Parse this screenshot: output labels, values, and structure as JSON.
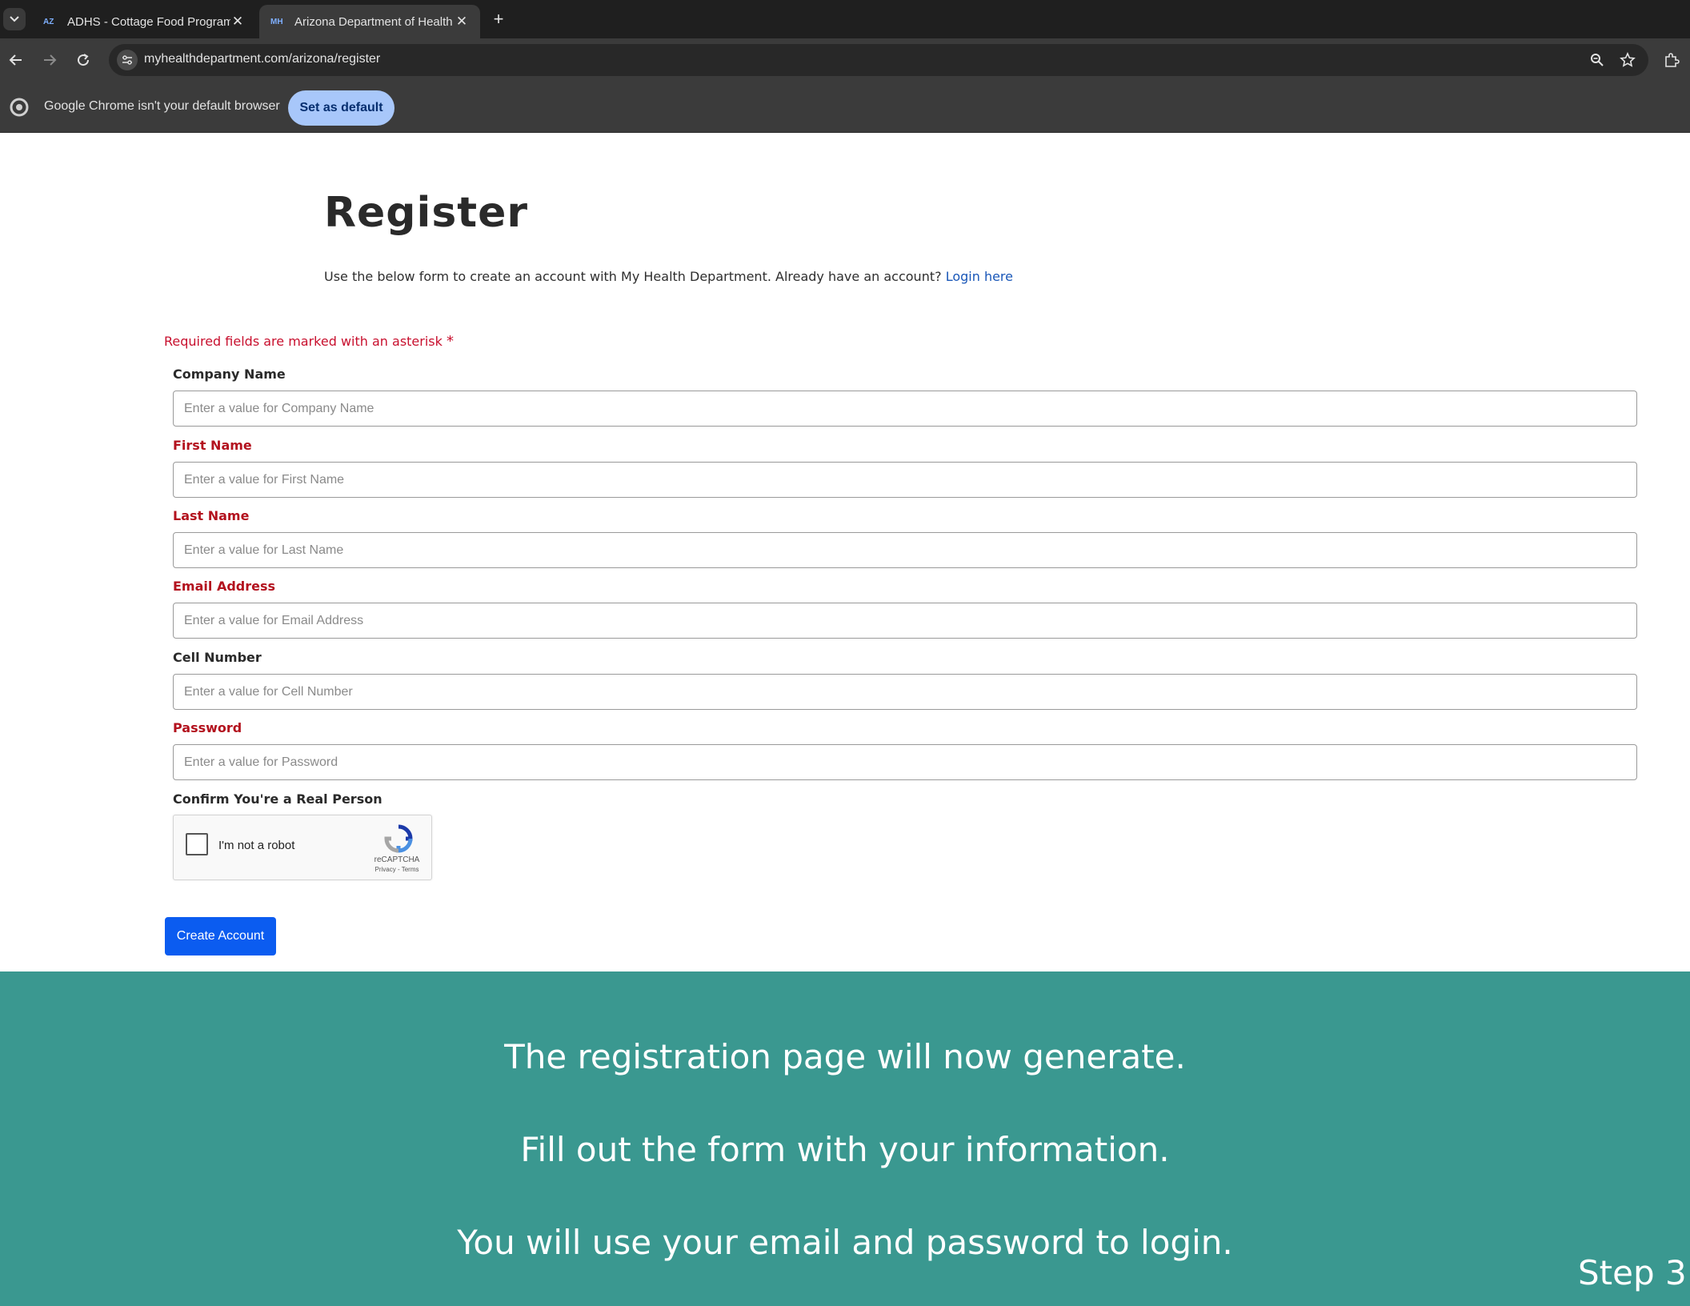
{
  "browser": {
    "tabs": [
      {
        "favicon": "AZ",
        "title": "ADHS - Cottage Food Program"
      },
      {
        "favicon": "MH",
        "title": "Arizona Department of Health S"
      }
    ],
    "url": "myhealthdepartment.com/arizona/register",
    "infobar": {
      "message": "Google Chrome isn't your default browser",
      "button": "Set as default"
    }
  },
  "page": {
    "title": "Register",
    "intro": "Use the below form to create an account with My Health Department. Already have an account?",
    "login_link": "Login here",
    "required_note": "Required fields are marked with an asterisk",
    "required_star": "*",
    "fields": [
      {
        "label": "Company Name",
        "placeholder": "Enter a value for Company Name",
        "required": false
      },
      {
        "label": "First Name",
        "placeholder": "Enter a value for First Name",
        "required": true
      },
      {
        "label": "Last Name",
        "placeholder": "Enter a value for Last Name",
        "required": true
      },
      {
        "label": "Email Address",
        "placeholder": "Enter a value for Email Address",
        "required": true
      },
      {
        "label": "Cell Number",
        "placeholder": "Enter a value for Cell Number",
        "required": false
      },
      {
        "label": "Password",
        "placeholder": "Enter a value for Password",
        "required": true
      }
    ],
    "captcha": {
      "label": "Confirm You're a Real Person",
      "checkbox_text": "I'm not a robot",
      "brand": "reCAPTCHA",
      "terms": "Privacy - Terms"
    },
    "submit": "Create Account"
  },
  "banner": {
    "lines": [
      "The registration page will now generate.",
      "Fill out the form with your information.",
      "You will use your email and password to login."
    ],
    "step": "Step 3"
  },
  "colors": {
    "banner": "#3a9890",
    "primary_button": "#0b5cf0",
    "required": "#b3121e",
    "link": "#1a57b8"
  }
}
